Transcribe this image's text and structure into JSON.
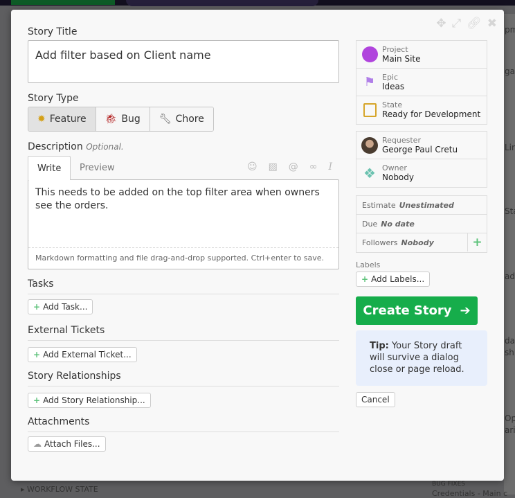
{
  "background": {
    "fragments": [
      "pm",
      "ga",
      "Link",
      "Stat",
      "ad",
      "dali",
      "shb",
      "Opt",
      "arin"
    ],
    "bug_fixes": "BUG FIXES",
    "credentials": "Credentials - Main c",
    "workflow_state": "WORKFLOW STATE"
  },
  "dialog": {
    "story_title_label": "Story Title",
    "story_title_value": "Add filter based on Client name",
    "story_type_label": "Story Type",
    "story_types": [
      {
        "label": "Feature",
        "icon": "feature-icon",
        "active": true
      },
      {
        "label": "Bug",
        "icon": "bug-icon",
        "active": false
      },
      {
        "label": "Chore",
        "icon": "wrench-icon",
        "active": false
      }
    ],
    "description_label": "Description",
    "description_optional": "Optional.",
    "tabs": {
      "write": "Write",
      "preview": "Preview"
    },
    "description_value": "This needs to be added on the top filter area when owners see the orders.",
    "description_footer": "Markdown formatting and file drag-and-drop supported. Ctrl+enter to save.",
    "tasks_label": "Tasks",
    "add_task": "Add Task...",
    "external_tickets_label": "External Tickets",
    "add_external_ticket": "Add External Ticket...",
    "relationships_label": "Story Relationships",
    "add_relationship": "Add Story Relationship...",
    "attachments_label": "Attachments",
    "attach_files": "Attach Files...",
    "sidebar": {
      "project_key": "Project",
      "project_value": "Main Site",
      "project_color": "#b044dd",
      "epic_key": "Epic",
      "epic_value": "Ideas",
      "state_key": "State",
      "state_value": "Ready for Development",
      "requester_key": "Requester",
      "requester_value": "George Paul Cretu",
      "owner_key": "Owner",
      "owner_value": "Nobody",
      "estimate_key": "Estimate",
      "estimate_value": "Unestimated",
      "due_key": "Due",
      "due_value": "No date",
      "followers_key": "Followers",
      "followers_value": "Nobody",
      "labels_label": "Labels",
      "add_labels": "Add Labels..."
    },
    "create_story": "Create Story",
    "tip_bold": "Tip:",
    "tip_text": "Your Story draft will survive a dialog close or page reload.",
    "cancel": "Cancel",
    "accent": "#16ad4b"
  }
}
